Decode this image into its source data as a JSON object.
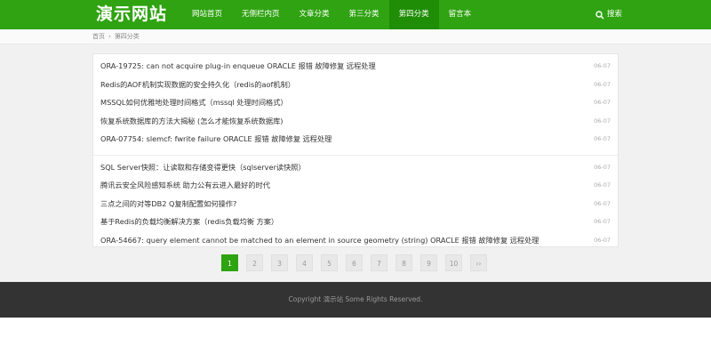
{
  "header": {
    "logo": "演示网站",
    "nav": [
      {
        "label": "网站首页"
      },
      {
        "label": "无侧栏内页"
      },
      {
        "label": "文章分类"
      },
      {
        "label": "第三分类"
      },
      {
        "label": "第四分类",
        "active": true
      },
      {
        "label": "留言本"
      }
    ],
    "search_label": "搜索",
    "search_icon": "search-icon"
  },
  "breadcrumb": {
    "home": "首页",
    "separator": "›",
    "current": "第四分类"
  },
  "list": {
    "group1": [
      {
        "title": "ORA-19725: can not acquire plug-in enqueue ORACLE 报错 故障修复 远程处理",
        "date": "06-07"
      },
      {
        "title": "Redis的AOF机制实现数据的安全持久化（redis的aof机制）",
        "date": "06-07"
      },
      {
        "title": "MSSQL如何优雅地处理时间格式（mssql 处理时间格式）",
        "date": "06-07"
      },
      {
        "title": "恢复系统数据库的方法大揭秘 (怎么才能恢复系统数据库)",
        "date": "06-07"
      },
      {
        "title": "ORA-07754: slemcf: fwrite failure ORACLE 报错 故障修复 远程处理",
        "date": "06-07"
      }
    ],
    "group2": [
      {
        "title": "SQL Server快照：让读取和存储变得更快（sqlserver读快照）",
        "date": "06-07"
      },
      {
        "title": "腾讯云安全风险感知系统 助力公有云进入最好的时代",
        "date": "06-07"
      },
      {
        "title": "三点之间的对等DB2 Q复制配置如何操作?",
        "date": "06-07"
      },
      {
        "title": "基于Redis的负载均衡解决方案（redis负载均衡 方案）",
        "date": "06-07"
      },
      {
        "title": "ORA-54667: query element cannot be matched to an element in source geometry (string) ORACLE 报错 故障修复 远程处理",
        "date": "06-07"
      }
    ]
  },
  "pagination": [
    "1",
    "2",
    "3",
    "4",
    "5",
    "6",
    "7",
    "8",
    "9",
    "10",
    "››"
  ],
  "footer": {
    "copyright": "Copyright 演示站 Some Rights Reserved."
  },
  "colors": {
    "brand": "#2fa311",
    "nav_active": "#1f8d06",
    "footer": "#333333"
  }
}
